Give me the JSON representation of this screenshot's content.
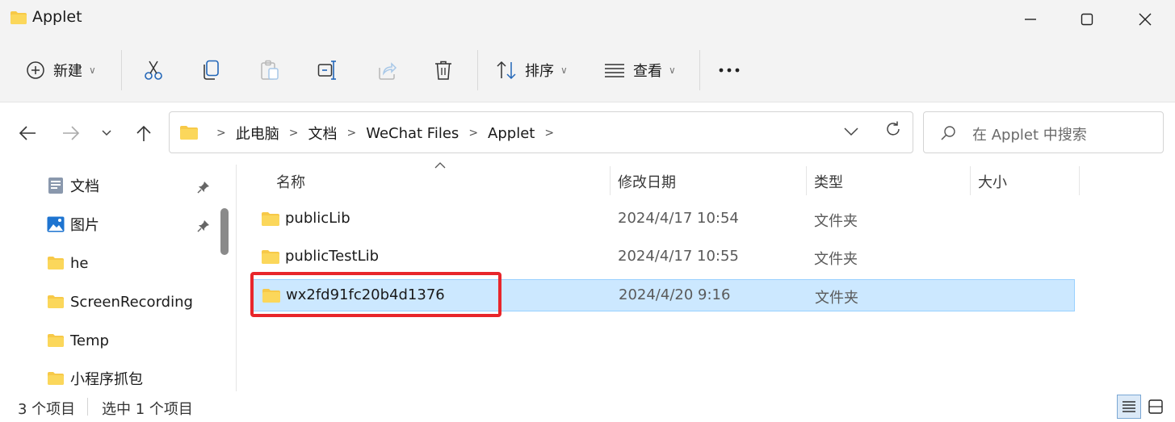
{
  "window": {
    "title": "Applet",
    "folder_color": "#f7c948"
  },
  "toolbar": {
    "new_label": "新建",
    "sort_label": "排序",
    "view_label": "查看",
    "icons": [
      "plus-circle-icon",
      "cut-icon",
      "copy-icon",
      "paste-icon",
      "rename-icon",
      "share-icon",
      "delete-icon",
      "sort-icon",
      "view-icon",
      "more-icon"
    ]
  },
  "address": {
    "crumbs": [
      "此电脑",
      "文档",
      "WeChat Files",
      "Applet"
    ]
  },
  "search": {
    "placeholder": "在 Applet 中搜索"
  },
  "nav_pane": {
    "items": [
      {
        "label": "文档",
        "icon": "documents-icon",
        "pinned": true
      },
      {
        "label": "图片",
        "icon": "pictures-icon",
        "pinned": true
      },
      {
        "label": "he",
        "icon": "folder-icon",
        "pinned": false
      },
      {
        "label": "ScreenRecording",
        "icon": "folder-icon",
        "pinned": false
      },
      {
        "label": "Temp",
        "icon": "folder-icon",
        "pinned": false
      },
      {
        "label": "小程序抓包",
        "icon": "folder-icon",
        "pinned": false
      }
    ]
  },
  "columns": {
    "name": "名称",
    "modified": "修改日期",
    "type": "类型",
    "size": "大小"
  },
  "files": [
    {
      "name": "publicLib",
      "modified": "2024/4/17 10:54",
      "type": "文件夹",
      "selected": false
    },
    {
      "name": "publicTestLib",
      "modified": "2024/4/17 10:55",
      "type": "文件夹",
      "selected": false
    },
    {
      "name": "wx2fd91fc20b4d1376",
      "modified": "2024/4/20 9:16",
      "type": "文件夹",
      "selected": true
    }
  ],
  "status": {
    "count": "3 个项目",
    "selected": "选中 1 个项目"
  },
  "colors": {
    "selection_bg": "#cce8ff",
    "selection_border": "#99d1ff",
    "highlight_red": "#e8262b"
  }
}
